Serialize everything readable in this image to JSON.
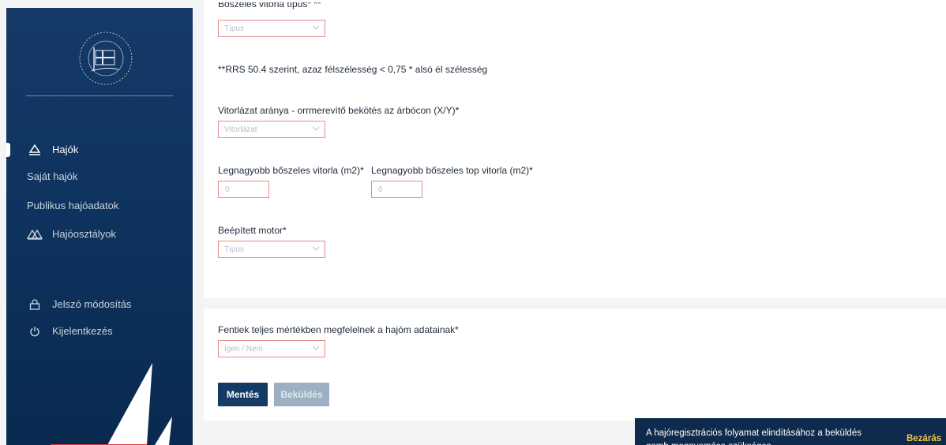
{
  "sidebar": {
    "nav": {
      "boats": "Hajók",
      "own_boats": "Saját hajók",
      "public_boat_data": "Publikus hajóadatok",
      "boat_classes": "Hajóosztályok",
      "change_password": "Jelszó módosítás",
      "logout": "Kijelentkezés"
    }
  },
  "form": {
    "spinnaker_type_label": "Bőszeles vitorla típus* **",
    "spinnaker_type_placeholder": "Típus",
    "rrs_note": "**RRS 50.4 szerint, azaz félszélesség < 0,75 * alsó él szélesség",
    "rig_ratio_label": "Vitorlázat aránya - orrmerevítő bekötés az árbócon (X/Y)*",
    "rig_ratio_placeholder": "Vitorlázat",
    "max_spinnaker_label": "Legnagyobb bőszeles vitorla (m2)*",
    "max_spinnaker_value": "0",
    "max_top_spinnaker_label": "Legnagyobb bőszeles top vitorla (m2)*",
    "max_top_spinnaker_value": "0",
    "engine_label": "Beépített motor*",
    "engine_placeholder": "Típus"
  },
  "confirm": {
    "label": "Fentiek teljes mértékben megfelelnek a hajóm adatainak*",
    "placeholder": "Igen / Nem",
    "save_button": "Mentés",
    "submit_button": "Beküldés"
  },
  "toast": {
    "message": "A hajóregisztrációs folyamat elindításához a beküldés gomb megnyomása szükséges.",
    "close_label": "Bezárás"
  },
  "colors": {
    "sidebar": "#0e335e",
    "primary_button": "#143a66",
    "disabled_button": "#9db0c3",
    "field_border": "#e58b8b",
    "toast_accent": "#f2c94c"
  }
}
